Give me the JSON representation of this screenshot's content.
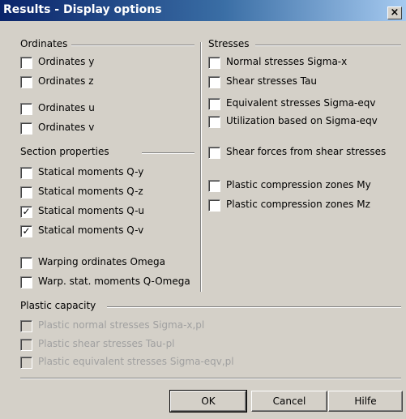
{
  "window": {
    "title": "Results - Display options",
    "close_label": "×"
  },
  "ordinates": {
    "heading": "Ordinates",
    "items": [
      {
        "label": "Ordinates y",
        "checked": false
      },
      {
        "label": "Ordinates z",
        "checked": false
      },
      {
        "label": "Ordinates u",
        "checked": false
      },
      {
        "label": "Ordinates v",
        "checked": false
      }
    ]
  },
  "section_properties": {
    "heading": "Section properties",
    "items": [
      {
        "label": "Statical moments Q-y",
        "checked": false
      },
      {
        "label": "Statical moments Q-z",
        "checked": false
      },
      {
        "label": "Statical moments Q-u",
        "checked": true
      },
      {
        "label": "Statical moments Q-v",
        "checked": true
      },
      {
        "label": "Warping ordinates Omega",
        "checked": false
      },
      {
        "label": "Warp. stat. moments Q-Omega",
        "checked": false
      }
    ]
  },
  "stresses": {
    "heading": "Stresses",
    "items": [
      {
        "label": "Normal stresses Sigma-x",
        "checked": false
      },
      {
        "label": "Shear stresses Tau",
        "checked": false
      },
      {
        "label": "Equivalent stresses Sigma-eqv",
        "checked": false
      },
      {
        "label": "Utilization based on Sigma-eqv",
        "checked": false
      },
      {
        "label": "Shear forces from shear stresses",
        "checked": false
      },
      {
        "label": "Plastic compression zones My",
        "checked": false
      },
      {
        "label": "Plastic compression zones Mz",
        "checked": false
      }
    ]
  },
  "plastic_capacity": {
    "heading": "Plastic capacity",
    "items": [
      {
        "label": "Plastic normal stresses Sigma-x,pl",
        "checked": false,
        "disabled": true
      },
      {
        "label": "Plastic shear stresses Tau-pl",
        "checked": false,
        "disabled": true
      },
      {
        "label": "Plastic equivalent stresses  Sigma-eqv,pl",
        "checked": false,
        "disabled": true
      }
    ]
  },
  "buttons": {
    "ok": "OK",
    "cancel": "Cancel",
    "help": "Hilfe"
  },
  "check_mark": "✓"
}
